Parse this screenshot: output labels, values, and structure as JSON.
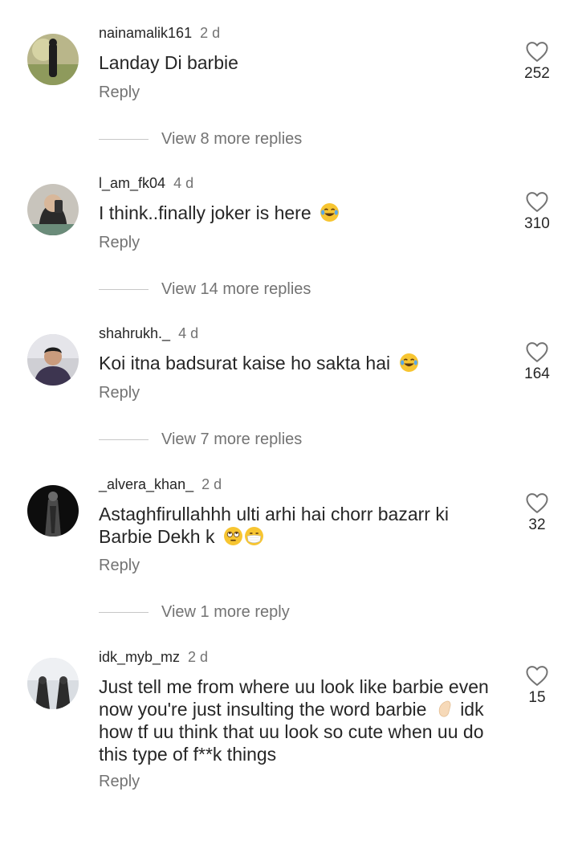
{
  "comments": [
    {
      "username": "nainamalik161",
      "time": "2 d",
      "text": "Landay Di barbie",
      "likes": "252",
      "reply_label": "Reply",
      "view_more": "View 8 more replies"
    },
    {
      "username": "l_am_fk04",
      "time": "4 d",
      "text": "I think..finally joker  is here",
      "likes": "310",
      "reply_label": "Reply",
      "view_more": "View 14 more replies"
    },
    {
      "username": "shahrukh._",
      "time": "4 d",
      "text": "Koi itna badsurat kaise ho sakta hai",
      "likes": "164",
      "reply_label": "Reply",
      "view_more": "View 7 more replies"
    },
    {
      "username": "_alvera_khan_",
      "time": "2 d",
      "text_line1": "Astaghfirullahhh ulti arhi hai chorr bazarr ki",
      "text_line2": "Barbie Dekh k",
      "likes": "32",
      "reply_label": "Reply",
      "view_more": "View 1 more reply"
    },
    {
      "username": "idk_myb_mz",
      "time": "2 d",
      "text_line1": "Just tell me from where uu look like barbie even",
      "text_line2": "now you're just insulting the word barbie",
      "text_line2b": "idk",
      "text_line3": "how tf uu think that uu look so cute when uu do",
      "text_line4": "this type of f**k things",
      "likes": "15",
      "reply_label": "Reply"
    }
  ],
  "icons": {
    "like": "heart-outline-icon",
    "laugh": "face-with-tears-of-joy-emoji",
    "eyeroll": "face-with-rolling-eyes-emoji",
    "mask": "face-with-medical-mask-emoji",
    "hand": "raised-hand-emoji"
  }
}
